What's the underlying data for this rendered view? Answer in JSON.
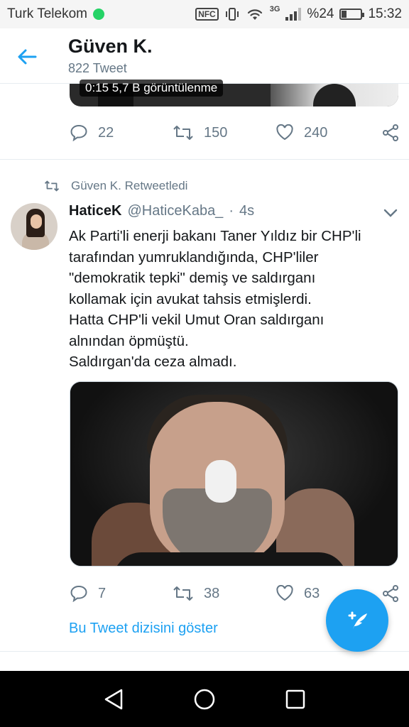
{
  "status_bar": {
    "carrier": "Turk Telekom",
    "nfc": "NFC",
    "network": "3G",
    "battery_text": "%24",
    "battery_level": 0.24,
    "time": "15:32"
  },
  "header": {
    "title": "Güven K.",
    "subtitle": "822 Tweet"
  },
  "previous_tweet": {
    "media_badge": "0:15  5,7 B görüntülenme",
    "replies": "22",
    "retweets": "150",
    "likes": "240"
  },
  "tweet": {
    "retweet_label": "Güven K. Retweetledi",
    "author_name": "HaticeK",
    "author_handle": "@HaticeKaba_",
    "separator": "·",
    "time": "4s",
    "text_lines": [
      "Ak Parti'li enerji bakanı Taner Yıldız bir CHP'li",
      "tarafından yumruklandığında, CHP'liler",
      "\"demokratik tepki\" demiş ve saldırganı",
      "kollamak için avukat tahsis etmişlerdi.",
      "Hatta CHP'li vekil Umut Oran saldırganı",
      "alnından öpmüştü.",
      "Saldırgan'da ceza almadı."
    ],
    "replies": "7",
    "retweets": "38",
    "likes": "63",
    "show_thread": "Bu Tweet dizisini göster"
  },
  "icons": {
    "back": "arrow-left-icon",
    "reply": "reply-icon",
    "retweet": "retweet-icon",
    "like": "heart-icon",
    "share": "share-icon",
    "compose": "compose-tweet-icon",
    "caret": "chevron-down-icon"
  },
  "colors": {
    "accent": "#1da1f2",
    "muted": "#657786",
    "text": "#14171a"
  }
}
